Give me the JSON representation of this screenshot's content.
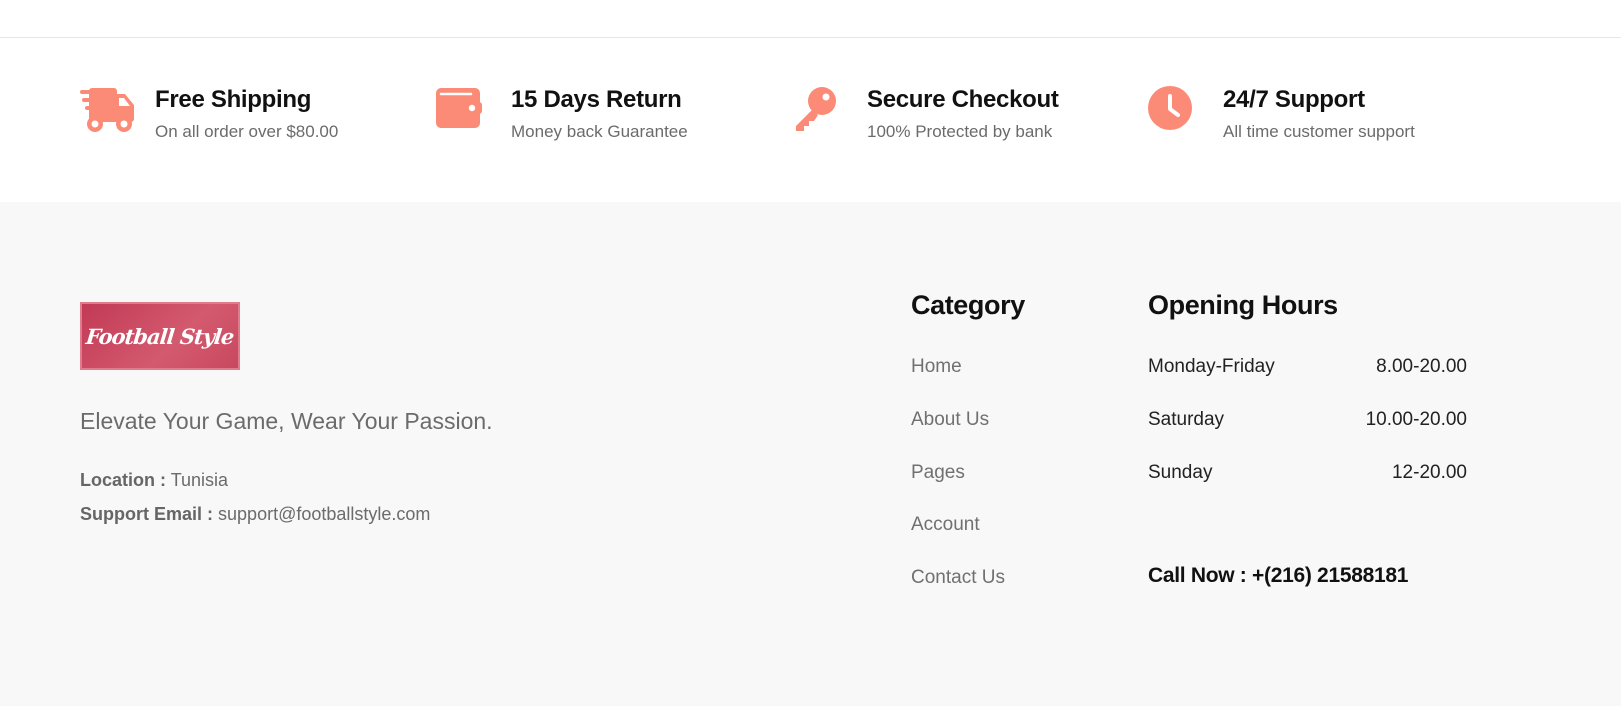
{
  "colors": {
    "accent": "#fb8b77",
    "footer_bg": "#f8f8f8"
  },
  "features": [
    {
      "icon": "truck-icon",
      "title": "Free Shipping",
      "subtitle": "On all order over $80.00"
    },
    {
      "icon": "wallet-icon",
      "title": "15 Days Return",
      "subtitle": "Money back Guarantee"
    },
    {
      "icon": "key-icon",
      "title": "Secure Checkout",
      "subtitle": "100% Protected by bank"
    },
    {
      "icon": "clock-icon",
      "title": "24/7 Support",
      "subtitle": "All time customer support"
    }
  ],
  "footer": {
    "logo_text": "Football Style",
    "tagline": "Elevate Your Game, Wear Your Passion.",
    "location_label": "Location :",
    "location_value": "Tunisia",
    "email_label": "Support Email :",
    "email_value": "support@footballstyle.com",
    "category": {
      "title": "Category",
      "links": [
        "Home",
        "About Us",
        "Pages",
        "Account",
        "Contact Us"
      ]
    },
    "hours": {
      "title": "Opening Hours",
      "rows": [
        {
          "day": "Monday-Friday",
          "time": "8.00-20.00"
        },
        {
          "day": "Saturday",
          "time": "10.00-20.00"
        },
        {
          "day": "Sunday",
          "time": "12-20.00"
        }
      ],
      "call_now": "Call Now : +(216) 21588181"
    }
  }
}
